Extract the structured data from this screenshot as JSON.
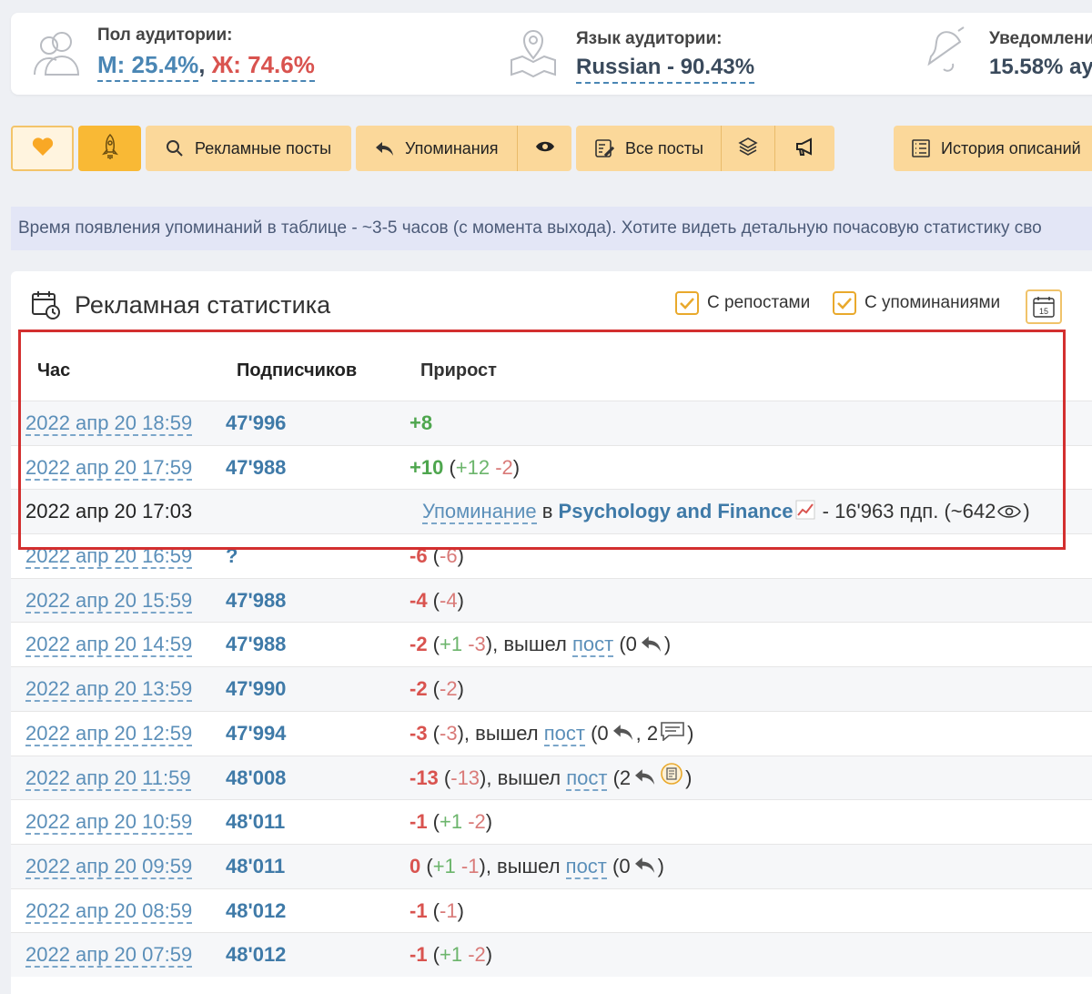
{
  "stats": {
    "gender": {
      "label": "Пол аудитории:",
      "male": "М: 25.4%",
      "sep": ",",
      "female": "Ж: 74.6%"
    },
    "language": {
      "label": "Язык аудитории:",
      "value": "Russian - 90.43%"
    },
    "notifications": {
      "label": "Уведомлени",
      "value": "15.58% ау"
    }
  },
  "toolbar": {
    "ads_label": "Рекламные посты",
    "mentions_label": "Упоминания",
    "all_posts_label": "Все посты",
    "history_label": "История описаний"
  },
  "banner": {
    "text": "Время появления упоминаний в таблице - ~3-5 часов (с момента выхода). Хотите видеть детальную почасовую статистику сво"
  },
  "panel": {
    "title": "Рекламная статистика",
    "checkbox_reposts": "С репостами",
    "checkbox_mentions": "С упоминаниями",
    "calendar_day": "15"
  },
  "table": {
    "headers": {
      "hour": "Час",
      "subs": "Подписчиков",
      "gain": "Прирост"
    },
    "rows": [
      {
        "time": "2022 апр 20 18:59",
        "subs": "47'996",
        "gain": "+8"
      },
      {
        "time": "2022 апр 20 17:59",
        "subs": "47'988",
        "gain": "+10",
        "plus": "+12",
        "minus": "-2"
      },
      {
        "time": "2022 апр 20 17:03",
        "mention": "Упоминание",
        "in": "в",
        "channel": "Psychology and Finance",
        "tail": "- 16'963 пдп. (~642"
      },
      {
        "time": "2022 апр 20 16:59",
        "subs": "?",
        "gain": "-6",
        "minus": "-6"
      },
      {
        "time": "2022 апр 20 15:59",
        "subs": "47'988",
        "gain": "-4",
        "minus": "-4"
      },
      {
        "time": "2022 апр 20 14:59",
        "subs": "47'988",
        "gain": "-2",
        "plus": "+1",
        "minus": "-3",
        "exited": ", вышел",
        "post": "пост",
        "count": "(0"
      },
      {
        "time": "2022 апр 20 13:59",
        "subs": "47'990",
        "gain": "-2",
        "minus": "-2"
      },
      {
        "time": "2022 апр 20 12:59",
        "subs": "47'994",
        "gain": "-3",
        "minus": "-3",
        "exited": ", вышел",
        "post": "пост",
        "count": "(0",
        "count2": ", 2"
      },
      {
        "time": "2022 апр 20 11:59",
        "subs": "48'008",
        "gain": "-13",
        "minus": "-13",
        "exited": ", вышел",
        "post": "пост",
        "count": "(2"
      },
      {
        "time": "2022 апр 20 10:59",
        "subs": "48'011",
        "gain": "-1",
        "plus": "+1",
        "minus": "-2"
      },
      {
        "time": "2022 апр 20 09:59",
        "subs": "48'011",
        "gain": "0",
        "plus": "+1",
        "minus": "-1",
        "exited": ", вышел",
        "post": "пост",
        "count": "(0"
      },
      {
        "time": "2022 апр 20 08:59",
        "subs": "48'012",
        "gain": "-1",
        "minus": "-1"
      },
      {
        "time": "2022 апр 20 07:59",
        "subs": "48'012",
        "gain": "-1",
        "plus": "+1",
        "minus": "-2"
      }
    ]
  },
  "colors": {
    "accent_orange": "#f9b935",
    "link_blue": "#5b8fb9",
    "positive": "#4ea64e",
    "negative": "#d9534f",
    "highlight": "#d32f2f"
  }
}
